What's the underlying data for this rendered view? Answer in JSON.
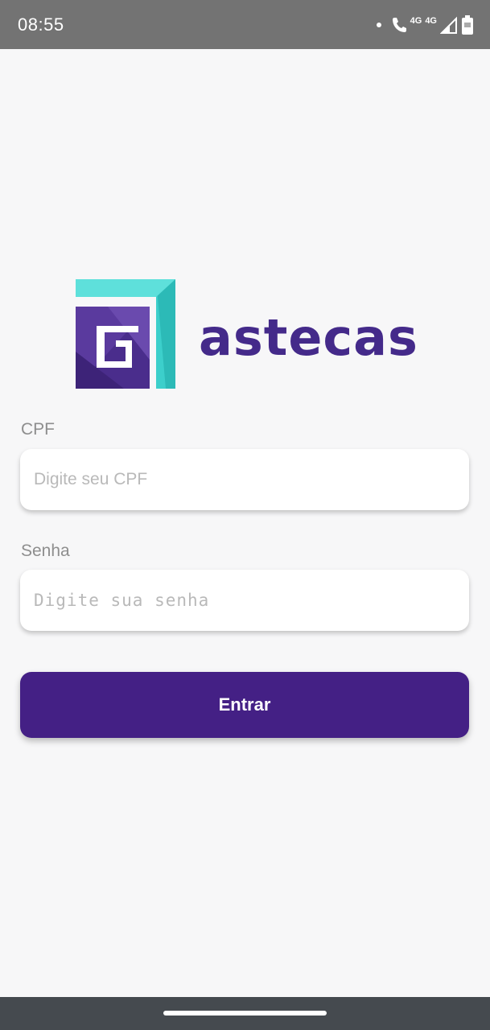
{
  "status_bar": {
    "time": "08:55",
    "network_1": "4G",
    "network_2": "4G",
    "battery_level": "66"
  },
  "brand": {
    "name": "astecas",
    "colors": {
      "primary": "#442085",
      "teal": "#3ccfcb",
      "purple_logo": "#4a2d8c"
    }
  },
  "form": {
    "cpf": {
      "label": "CPF",
      "placeholder": "Digite seu CPF",
      "value": ""
    },
    "password": {
      "label": "Senha",
      "placeholder": "Digite sua senha",
      "value": ""
    },
    "submit_label": "Entrar"
  }
}
